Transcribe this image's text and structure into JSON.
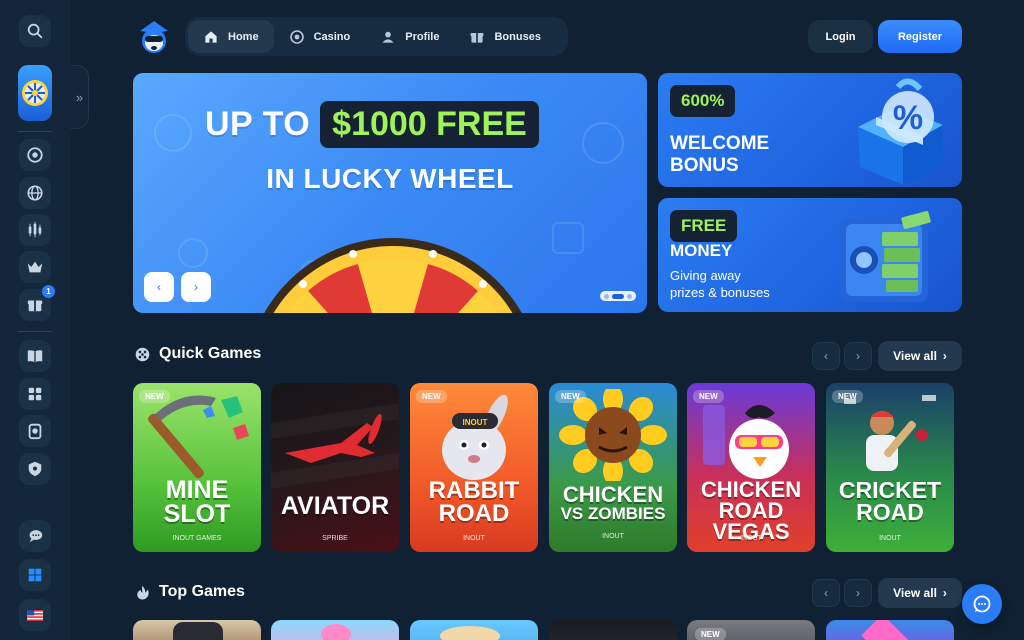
{
  "nav": {
    "items": [
      {
        "label": "Home",
        "icon": "home-icon",
        "active": true
      },
      {
        "label": "Casino",
        "icon": "casino-chip-icon"
      },
      {
        "label": "Profile",
        "icon": "user-icon"
      },
      {
        "label": "Bonuses",
        "icon": "gift-icon"
      }
    ]
  },
  "auth": {
    "login": "Login",
    "register": "Register"
  },
  "hero": {
    "line1_prefix": "UP TO",
    "line1_amount": "$1000 FREE",
    "line2": "IN LUCKY WHEEL",
    "prev": "‹",
    "next": "›",
    "active_slide": 1,
    "slide_count": 3
  },
  "promos": [
    {
      "tag": "600%",
      "title_1": "WELCOME",
      "title_2": "BONUS"
    },
    {
      "tag": "FREE",
      "title": "MONEY",
      "sub_1": "Giving away",
      "sub_2": "prizes & bonuses"
    }
  ],
  "sidebar": {
    "expand": "»",
    "badge": "1"
  },
  "quick_games": {
    "title": "Quick Games",
    "view_all": "View all",
    "games": [
      {
        "name_1": "MINE",
        "name_2": "SLOT",
        "provider": "INOUT GAMES",
        "new": "NEW"
      },
      {
        "name_1": "AVIATOR",
        "name_2": "",
        "provider": "SPRIBE",
        "new": ""
      },
      {
        "name_1": "RABBIT",
        "name_2": "ROAD",
        "provider": "INOUT",
        "new": "NEW"
      },
      {
        "name_1": "CHICKEN",
        "name_2": "VS ZOMBIES",
        "provider": "INOUT",
        "new": "NEW"
      },
      {
        "name_1": "CHICKEN",
        "name_2": "ROAD VEGAS",
        "provider": "INOUT",
        "new": "NEW"
      },
      {
        "name_1": "CRICKET",
        "name_2": "ROAD",
        "provider": "INOUT",
        "new": "NEW"
      }
    ]
  },
  "top_games": {
    "title": "Top Games",
    "view_all": "View all",
    "new_badge": "NEW"
  },
  "colors": {
    "accent": "#2a7cf7",
    "bg": "#0f2132",
    "green": "#9ff25a"
  }
}
